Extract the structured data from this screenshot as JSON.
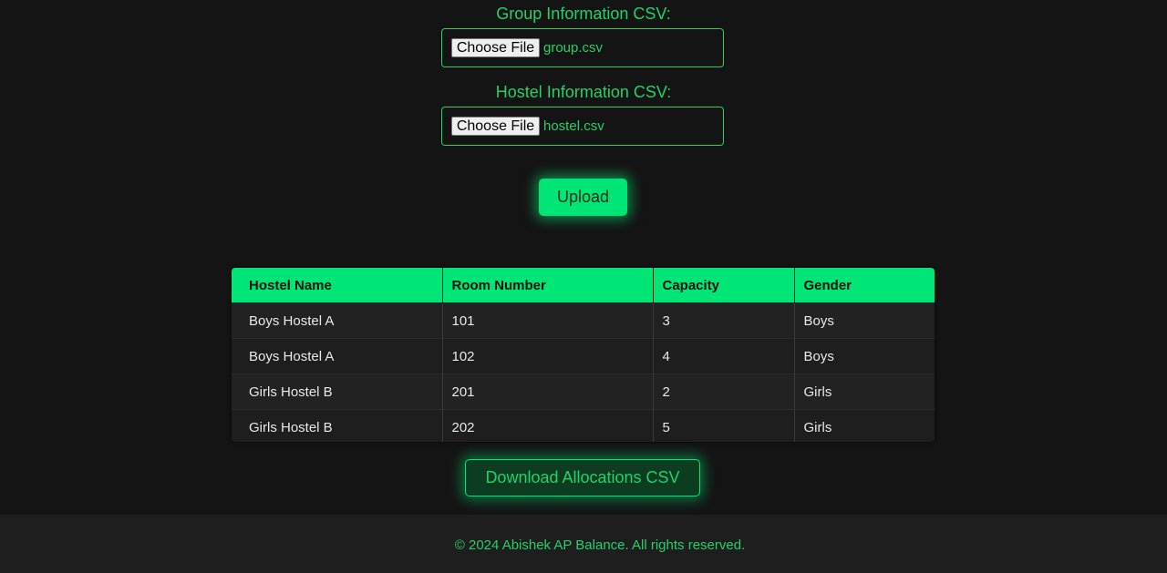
{
  "upload_form": {
    "group_label": "Group Information CSV:",
    "group_button": "Choose File",
    "group_file": "group.csv",
    "hostel_label": "Hostel Information CSV:",
    "hostel_button": "Choose File",
    "hostel_file": "hostel.csv",
    "upload_button": "Upload"
  },
  "table": {
    "headers": [
      "Hostel Name",
      "Room Number",
      "Capacity",
      "Gender"
    ],
    "rows": [
      [
        "Boys Hostel A",
        "101",
        "3",
        "Boys"
      ],
      [
        "Boys Hostel A",
        "102",
        "4",
        "Boys"
      ],
      [
        "Girls Hostel B",
        "201",
        "2",
        "Girls"
      ],
      [
        "Girls Hostel B",
        "202",
        "5",
        "Girls"
      ]
    ]
  },
  "download_button": "Download Allocations CSV",
  "footer": {
    "text": "© 2024 Abishek AP Balance. All rights reserved."
  },
  "colors": {
    "accent": "#00e676",
    "text_accent": "#22d16a",
    "background": "#141414"
  }
}
